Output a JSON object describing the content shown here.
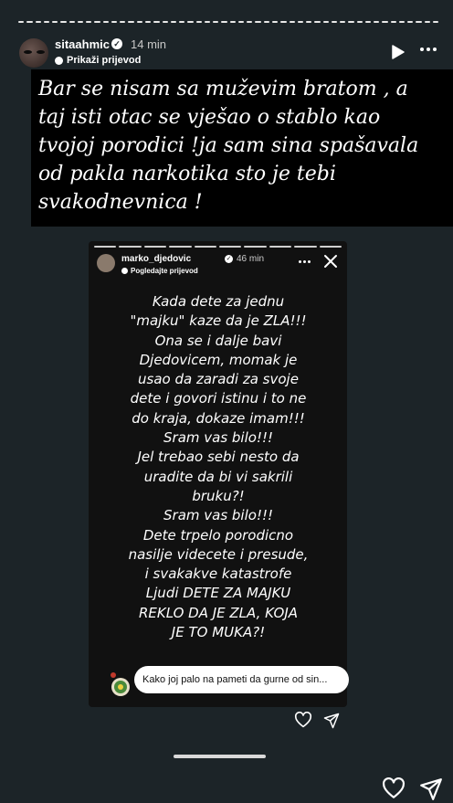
{
  "header": {
    "username": "sitaahmic",
    "time": "14 min",
    "translate_label": "Prikaži prijevod"
  },
  "story": {
    "quote_lines": [
      "Bar se nisam sa muževim bratom , a",
      "taj isti otac se vješao o stablo kao",
      "tvojoj porodici !ja sam sina spašavala",
      "od pakla narkotika sto je tebi",
      "svakodnevnica !"
    ]
  },
  "shared_story": {
    "username": "marko_djedovic",
    "time": "46 min",
    "translate_label": "Pogledajte prijevod",
    "lines": [
      "Kada dete za jednu",
      "\"majku\" kaze da je ZLA!!!",
      "Ona se i dalje bavi",
      "Djedovicem, momak je",
      "usao da zaradi za svoje",
      "dete i govori istinu i to ne",
      "do kraja, dokaze imam!!!",
      "Sram vas bilo!!!",
      "Jel trebao sebi nesto da",
      "uradite da bi vi sakrili",
      "bruku?!",
      "Sram vas bilo!!!",
      "Dete trpelo porodicno",
      "nasilje videcete i presude,",
      "i svakakve katastrofe",
      "Ljudi DETE ZA MAJKU",
      "REKLO DA JE ZLA, KOJA",
      "JE TO MUKA?!"
    ],
    "reply_text": "Kako joj palo na pameti da gurne od sin..."
  },
  "colors": {
    "background": "#1c2428",
    "quote_background": "#000000",
    "inner_background": "#111111"
  }
}
